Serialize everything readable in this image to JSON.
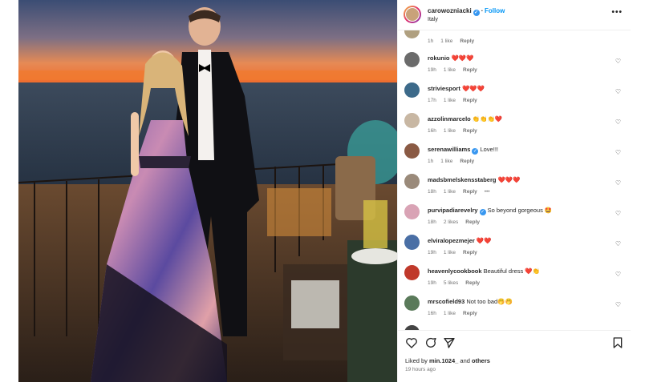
{
  "post": {
    "username": "carowozniacki",
    "follow_label": "Follow",
    "location": "Italy",
    "more_label": "•••",
    "next_label": "›"
  },
  "comments": [
    {
      "user": "",
      "text": "",
      "time": "1h",
      "likes": "1 like",
      "reply": "Reply",
      "avatar_color": "#b0a080"
    },
    {
      "user": "rokunio",
      "text": "❤️❤️❤️",
      "time": "19h",
      "likes": "1 like",
      "reply": "Reply",
      "avatar_color": "#6b6b6b"
    },
    {
      "user": "striviesport",
      "text": "❤️❤️❤️",
      "time": "17h",
      "likes": "1 like",
      "reply": "Reply",
      "avatar_color": "#3d6a8a"
    },
    {
      "user": "azzolinmarcelo",
      "text": "👏👏👏❤️",
      "time": "16h",
      "likes": "1 like",
      "reply": "Reply",
      "avatar_color": "#c8b7a3"
    },
    {
      "user": "serenawilliams",
      "verified": true,
      "text": "Love!!!",
      "time": "1h",
      "likes": "1 like",
      "reply": "Reply",
      "avatar_color": "#8a5a44"
    },
    {
      "user": "madsbmelskensstaberg",
      "text": "❤️❤️❤️",
      "time": "18h",
      "likes": "1 like",
      "reply": "Reply",
      "more": "•••",
      "avatar_color": "#9a8a7a"
    },
    {
      "user": "purvipadiarevelry",
      "verified": true,
      "text": "So beyond gorgeous 🤩",
      "time": "18h",
      "likes": "2 likes",
      "reply": "Reply",
      "avatar_color": "#d9a3b5"
    },
    {
      "user": "elviralopezmejer",
      "text": "❤️❤️",
      "time": "19h",
      "likes": "1 like",
      "reply": "Reply",
      "avatar_color": "#4a6fa5"
    },
    {
      "user": "heavenlycookbook",
      "text": "Beautiful dress ❤️👏",
      "time": "19h",
      "likes": "5 likes",
      "reply": "Reply",
      "avatar_color": "#c0392b"
    },
    {
      "user": "mrscofield93",
      "text": "Not too bad🤭🤭",
      "time": "16h",
      "likes": "1 like",
      "reply": "Reply",
      "avatar_color": "#5a7a5a"
    }
  ],
  "footer": {
    "liked_prefix": "Liked by",
    "liked_user": "min.1024_",
    "liked_and": "and",
    "liked_others": "others",
    "time_ago": "19 hours ago"
  }
}
